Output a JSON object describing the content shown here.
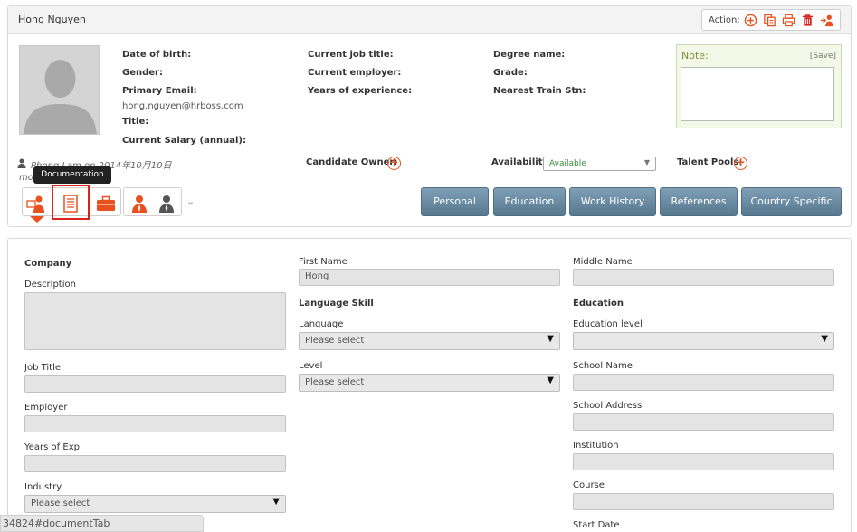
{
  "header": {
    "candidate_name": "Hong Nguyen",
    "action_label": "Action:",
    "actions": [
      "add-icon",
      "copy-icon",
      "print-icon",
      "delete-icon",
      "transfer-user-icon"
    ]
  },
  "profile": {
    "col1": {
      "dob_label": "Date of birth:",
      "gender_label": "Gender:",
      "email_label": "Primary Email:",
      "email_value": "hong.nguyen@hrboss.com",
      "title_label": "Title:",
      "salary_label": "Current Salary (annual):"
    },
    "col2": {
      "job_title_label": "Current job title:",
      "employer_label": "Current employer:",
      "experience_label": "Years of experience:"
    },
    "col3": {
      "degree_label": "Degree name:",
      "grade_label": "Grade:",
      "train_label": "Nearest Train Stn:"
    },
    "note": {
      "label": "Note:",
      "save": "[Save]"
    },
    "owner_text": "Phong Lam on 2014年10月10日",
    "owner_text2": "mo",
    "candidate_owner_label": "Candidate Owner:",
    "availability_label": "Availability:",
    "availability_value": "Available",
    "talent_pools_label": "Talent Pools:"
  },
  "tooltip": "Documentation",
  "tabs": [
    "Personal",
    "Education",
    "Work History",
    "References",
    "Country Specific"
  ],
  "form": {
    "left": {
      "company_heading": "Company",
      "description_label": "Description",
      "job_title_label": "Job Title",
      "employer_label": "Employer",
      "years_exp_label": "Years of Exp",
      "industry_label": "Industry",
      "industry_value": "Please select"
    },
    "middle": {
      "first_name_label": "First Name",
      "first_name_value": "Hong",
      "language_heading": "Language Skill",
      "language_label": "Language",
      "language_value": "Please select",
      "level_label": "Level",
      "level_value": "Please select"
    },
    "right": {
      "middle_name_label": "Middle Name",
      "education_heading": "Education",
      "education_level_label": "Education level",
      "school_name_label": "School Name",
      "school_address_label": "School Address",
      "institution_label": "Institution",
      "course_label": "Course",
      "start_date_label": "Start Date"
    }
  },
  "status_bar": "34824#documentTab"
}
